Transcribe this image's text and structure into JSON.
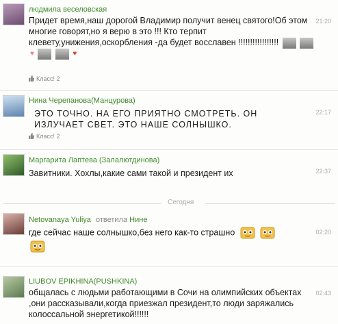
{
  "comments": [
    {
      "author": "людмила веселовская",
      "time": "21:20",
      "text": "Придет время,наш дорогой Владимир получит венец святого!Об этом многие говорят,но я верю в это !!! Кто терпит клевету,унижения,оскорбления -да будет восславен !!!!!!!!!!!!!!!!!",
      "likes": "Класс! 2",
      "avatar_color": "#8a6a8e"
    },
    {
      "author": "Нина Черепанова(Манцурова)",
      "time": "22:17",
      "text": "ЭТО ТОЧНО. НА ЕГО ПРИЯТНО СМОТРЕТЬ. ОН ИЗЛУЧАЕТ СВЕТ. ЭТО НАШЕ СОЛНЫШКО.",
      "likes": "Класс! 2",
      "avatar_color": "#7a9cc4"
    },
    {
      "author": "Маргарита Лаптева (Залалютдинова)",
      "time": "22:37",
      "text": "Завитники. Хохлы,какие сами такой и президент их",
      "avatar_color": "#4f7a3a"
    },
    {
      "author": "Netovanaya Yuliya",
      "reply_label": "ответила",
      "reply_to": "Нине",
      "time": "02:20",
      "text": "где сейчас наше солнышко,без него как-то страшно",
      "avatar_color": "#9a6a62"
    },
    {
      "author": "LIUBOV EPIKHINA(PUSHKINA)",
      "time": "02:43",
      "text": "общалась с людьми работающими в Сочи на олимпийских объектах ,они рассказывали,когда приезжал президент,то люди заряжались колоссальной энергетикой!!!!!!",
      "avatar_color": "#7d9a6a"
    }
  ],
  "day_separator": "Сегодня",
  "colors": {
    "author": "#3f8a2c",
    "time": "#aaaaaa",
    "heart": "#e87aa8"
  },
  "icons": {
    "like": "thumbs-up-icon",
    "sticker": "smiley-sticker-icon",
    "putin_face": "face-sticker-icon"
  }
}
